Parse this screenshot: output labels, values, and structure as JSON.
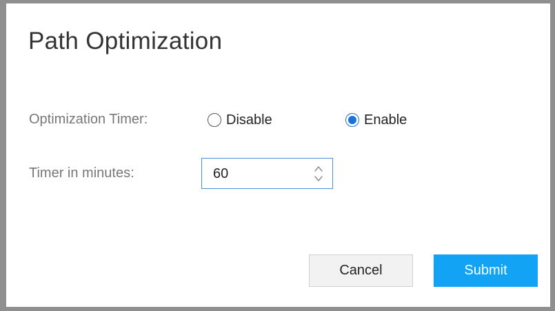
{
  "dialog": {
    "title": "Path Optimization"
  },
  "form": {
    "timer_label": "Optimization Timer:",
    "timer_options": [
      {
        "label": "Disable",
        "checked": false
      },
      {
        "label": "Enable",
        "checked": true
      }
    ],
    "minutes_label": "Timer in minutes:",
    "minutes_value": "60"
  },
  "actions": {
    "cancel_label": "Cancel",
    "submit_label": "Submit"
  },
  "colors": {
    "accent": "#1a73d9",
    "submit_bg": "#12a3f5",
    "frame": "#8f8f8f"
  },
  "icons": {
    "spinner": "up-down-chevron-icon"
  }
}
